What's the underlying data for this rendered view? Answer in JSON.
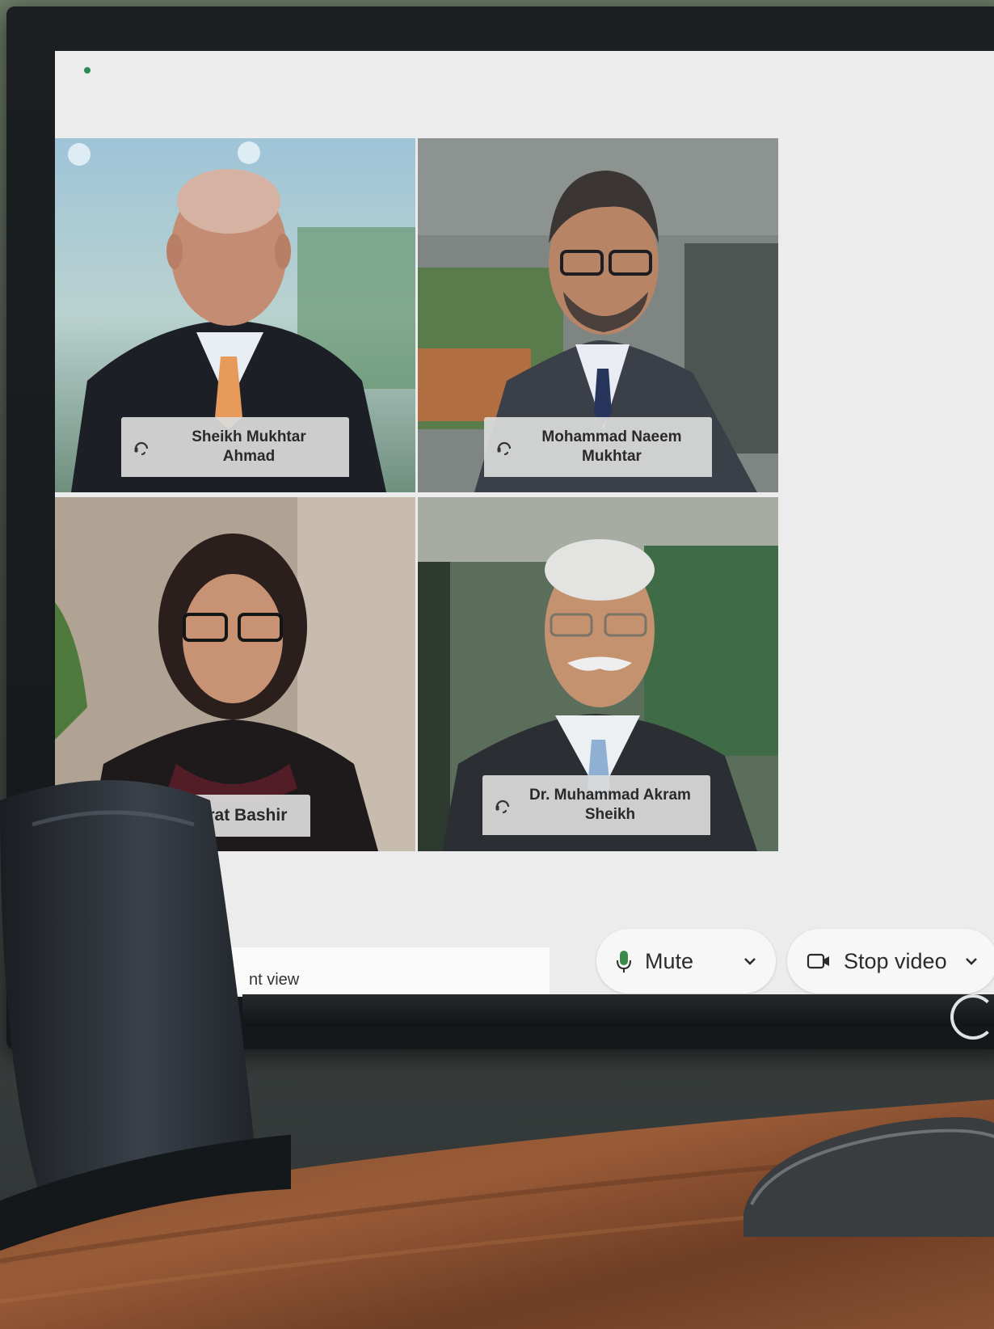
{
  "call": {
    "participants": [
      {
        "name": "Sheikh Mukhtar Ahmad"
      },
      {
        "name": "Mohammad Naeem Mukhtar"
      },
      {
        "name": "Nazrat Bashir"
      },
      {
        "name": "Dr. Muhammad Akram Sheikh"
      }
    ],
    "name_lines": {
      "p1_l1": "Sheikh Mukhtar",
      "p1_l2": "Ahmad",
      "p2_l1": "Mohammad Naeem",
      "p2_l2": "Mukhtar",
      "p3_l1": "Nazrat Bashir",
      "p4_l1": "Dr. Muhammad Akram",
      "p4_l2": "Sheikh"
    },
    "view_label": "nt view",
    "controls": {
      "mute_label": "Mute",
      "stop_video_label": "Stop video"
    },
    "icons": {
      "participant_audio": "headset-icon",
      "mute": "microphone-icon",
      "video": "video-camera-icon",
      "dropdown": "chevron-down-icon"
    },
    "colors": {
      "status_dot": "#2e8b57",
      "mic_green": "#3a8a4a"
    }
  }
}
